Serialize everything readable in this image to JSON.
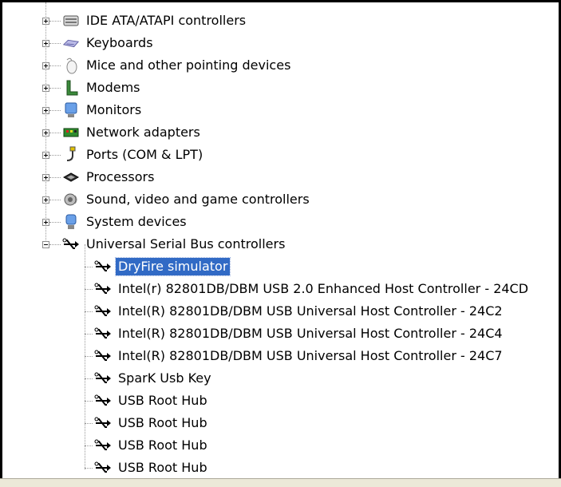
{
  "tree": {
    "categories": [
      {
        "label": "IDE ATA/ATAPI controllers",
        "icon": "ide-controller-icon"
      },
      {
        "label": "Keyboards",
        "icon": "keyboard-icon"
      },
      {
        "label": "Mice and other pointing devices",
        "icon": "mouse-icon"
      },
      {
        "label": "Modems",
        "icon": "modem-icon"
      },
      {
        "label": "Monitors",
        "icon": "monitor-icon"
      },
      {
        "label": "Network adapters",
        "icon": "network-adapter-icon"
      },
      {
        "label": "Ports (COM & LPT)",
        "icon": "port-icon"
      },
      {
        "label": "Processors",
        "icon": "processor-icon"
      },
      {
        "label": "Sound, video and game controllers",
        "icon": "sound-icon"
      },
      {
        "label": "System devices",
        "icon": "system-device-icon"
      },
      {
        "label": "Universal Serial Bus controllers",
        "icon": "usb-icon",
        "expanded": true
      }
    ],
    "usb_children": [
      {
        "label": "DryFire simulator",
        "selected": true
      },
      {
        "label": "Intel(r) 82801DB/DBM USB 2.0 Enhanced Host Controller - 24CD"
      },
      {
        "label": "Intel(R) 82801DB/DBM USB Universal Host Controller - 24C2"
      },
      {
        "label": "Intel(R) 82801DB/DBM USB Universal Host Controller - 24C4"
      },
      {
        "label": "Intel(R) 82801DB/DBM USB Universal Host Controller - 24C7"
      },
      {
        "label": "SparK Usb Key"
      },
      {
        "label": "USB Root Hub"
      },
      {
        "label": "USB Root Hub"
      },
      {
        "label": "USB Root Hub"
      },
      {
        "label": "USB Root Hub"
      }
    ]
  },
  "colors": {
    "selection": "#316ac5",
    "tree_lines": "#999999"
  }
}
